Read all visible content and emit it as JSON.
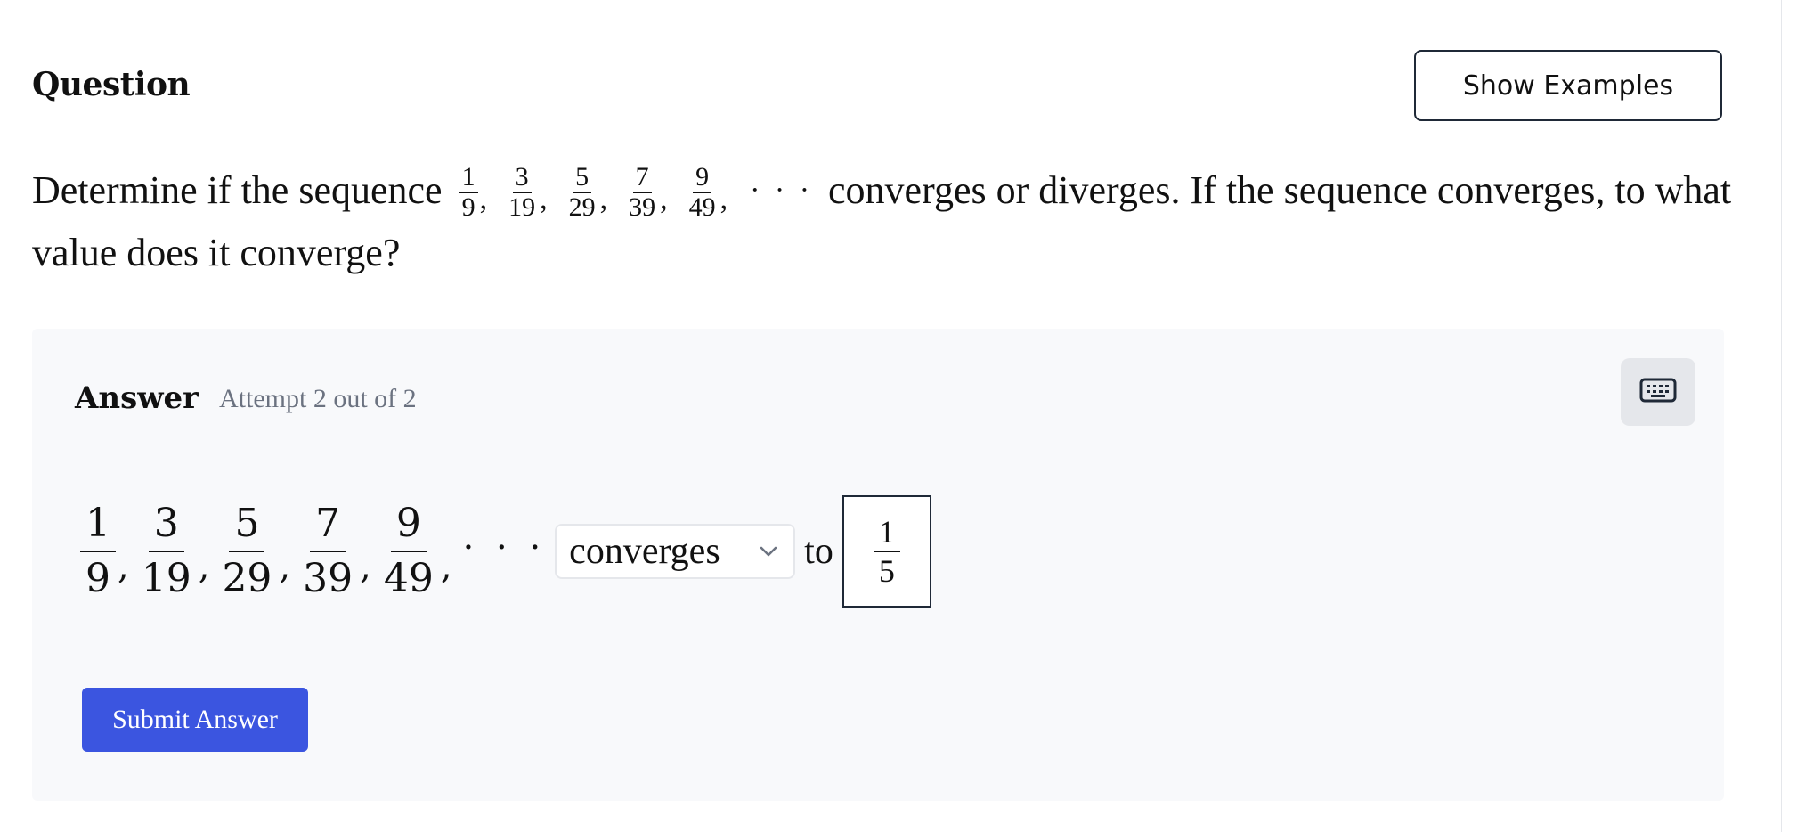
{
  "header": {
    "title": "Question",
    "show_examples_label": "Show Examples"
  },
  "question": {
    "text_before": "Determine if the sequence",
    "sequence": [
      {
        "num": "1",
        "den": "9"
      },
      {
        "num": "3",
        "den": "19"
      },
      {
        "num": "5",
        "den": "29"
      },
      {
        "num": "7",
        "den": "39"
      },
      {
        "num": "9",
        "den": "49"
      }
    ],
    "ellipsis": "· · ·",
    "text_after": "converges or diverges. If the sequence converges, to what value does it converge?"
  },
  "answer": {
    "label": "Answer",
    "attempt_text": "Attempt 2 out of 2",
    "keyboard_icon": "keyboard-icon",
    "sequence": [
      {
        "num": "1",
        "den": "9"
      },
      {
        "num": "3",
        "den": "19"
      },
      {
        "num": "5",
        "den": "29"
      },
      {
        "num": "7",
        "den": "39"
      },
      {
        "num": "9",
        "den": "49"
      }
    ],
    "ellipsis": "· · ·",
    "select_value": "converges",
    "to_text": "to",
    "input_value": {
      "num": "1",
      "den": "5"
    },
    "submit_label": "Submit Answer"
  },
  "colors": {
    "submit_bg": "#3b55e0",
    "panel_bg": "#f8f9fb",
    "muted_text": "#6b7280"
  }
}
